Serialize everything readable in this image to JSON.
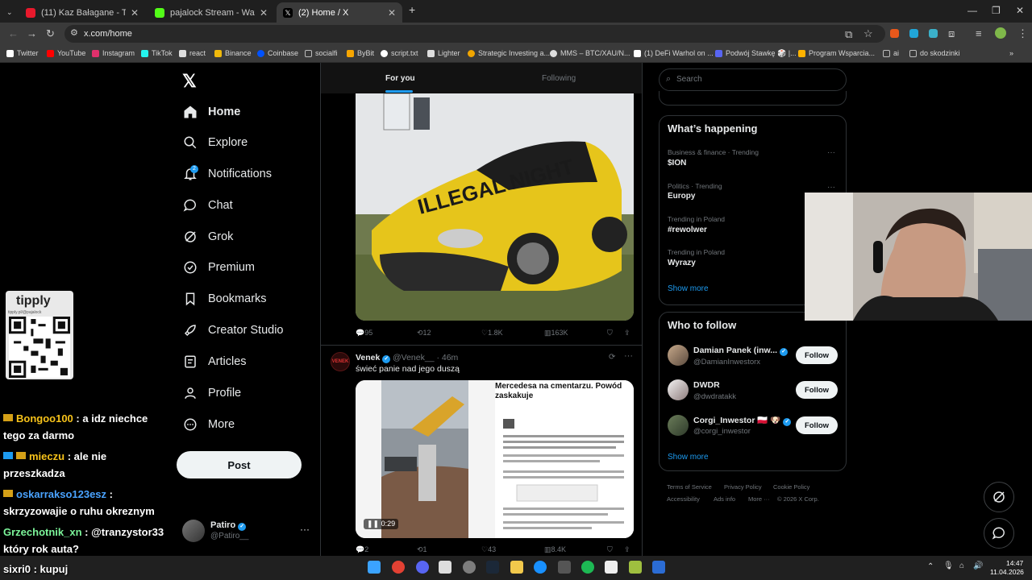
{
  "browser": {
    "tabs": [
      {
        "title": "(11) Kaz Bałagane - Trendsetter",
        "color": "#e8192c"
      },
      {
        "title": "pajalock Stream - Watch Live o",
        "color": "#53fc18"
      },
      {
        "title": "(2) Home / X",
        "color": "#000000"
      }
    ],
    "url": "x.com/home",
    "bookmarks": [
      {
        "label": "Twitter",
        "color": "#ffffff"
      },
      {
        "label": "YouTube",
        "color": "#ff0000"
      },
      {
        "label": "Instagram",
        "color": "#e1306c"
      },
      {
        "label": "TikTok",
        "color": "#25f4ee"
      },
      {
        "label": "react",
        "color": "#dddddd"
      },
      {
        "label": "Binance",
        "color": "#f0b90b"
      },
      {
        "label": "Coinbase",
        "color": "#0052ff"
      },
      {
        "label": "socialfi",
        "color": "#aaaaaa"
      },
      {
        "label": "ByBit",
        "color": "#f7a600"
      },
      {
        "label": "script.txt",
        "color": "#ffffff"
      },
      {
        "label": "Lighter",
        "color": "#dddddd"
      },
      {
        "label": "Strategic Investing a...",
        "color": "#f0a500"
      },
      {
        "label": "MMS – BTC/XAU/N...",
        "color": "#dddddd"
      },
      {
        "label": "(1) DeFi Warhol on ...",
        "color": "#ffffff"
      },
      {
        "label": "Podwój Stawkę 🎲 |...",
        "color": "#5865f2"
      },
      {
        "label": "Program Wsparcia...",
        "color": "#ffb300"
      },
      {
        "label": "ai",
        "color": "#aaaaaa"
      },
      {
        "label": "do skodzinki",
        "color": "#aaaaaa"
      }
    ]
  },
  "x": {
    "nav": [
      {
        "label": "Home",
        "icon": "home-icon"
      },
      {
        "label": "Explore",
        "icon": "search-icon"
      },
      {
        "label": "Notifications",
        "icon": "bell-icon"
      },
      {
        "label": "Chat",
        "icon": "chat-icon"
      },
      {
        "label": "Grok",
        "icon": "grok-icon"
      },
      {
        "label": "Premium",
        "icon": "premium-icon"
      },
      {
        "label": "Bookmarks",
        "icon": "bookmark-icon"
      },
      {
        "label": "Creator Studio",
        "icon": "rocket-icon"
      },
      {
        "label": "Articles",
        "icon": "articles-icon"
      },
      {
        "label": "Profile",
        "icon": "profile-icon"
      },
      {
        "label": "More",
        "icon": "more-icon"
      }
    ],
    "notification_count": "2",
    "post_label": "Post",
    "profile": {
      "name": "Patiro",
      "handle": "@Patiro__"
    }
  },
  "timeline": {
    "tabs": {
      "for_you": "For you",
      "following": "Following"
    },
    "tweet1": {
      "stats": {
        "replies": "95",
        "reposts": "12",
        "likes": "1.8K",
        "views": "163K"
      }
    },
    "tweet2": {
      "avatar_text": "VENEK",
      "name": "Venek",
      "handle": "@Venek__ · 46m",
      "text": "świeć panie nad jego duszą",
      "video_duration": "0:29",
      "article_headline": "Mercedesa na cmentarzu. Powód zaskakuje",
      "stats": {
        "replies": "2",
        "reposts": "1",
        "likes": "43",
        "views": "8.4K"
      }
    }
  },
  "sidebar": {
    "search_placeholder": "Search",
    "whats_happening_title": "What’s happening",
    "trends": [
      {
        "category": "Business & finance · Trending",
        "name": "$ION"
      },
      {
        "category": "Politics · Trending",
        "name": "Europy"
      },
      {
        "category": "Trending in Poland",
        "name": "#rewolwer"
      },
      {
        "category": "Trending in Poland",
        "name": "Wyrazy"
      }
    ],
    "show_more": "Show more",
    "who_to_follow_title": "Who to follow",
    "follow_label": "Follow",
    "suggestions": [
      {
        "name": "Damian Panek (inw...",
        "handle": "@DamianInwestorx",
        "verified": true
      },
      {
        "name": "DWDR",
        "handle": "@dwdratakk",
        "verified": false
      },
      {
        "name": "Corgi_Inwestor 🇵🇱 🐶",
        "handle": "@corgi_inwestor",
        "verified": true
      }
    ],
    "footer": [
      "Terms of Service",
      "Privacy Policy",
      "Cookie Policy",
      "Accessibility",
      "Ads info",
      "More ···",
      "© 2026 X Corp."
    ]
  },
  "overlay": {
    "tipply_title": "tipply",
    "tipply_url": "tipply.pl/@pajalock",
    "chat": [
      {
        "user": "Bongoo100",
        "message": ": a idz niechce tego za darmo",
        "color": "#f6c21a"
      },
      {
        "user": "mieczu",
        "message": ": ale nie przeszkadza",
        "color": "#f6c21a"
      },
      {
        "user": "oskarrakso123esz",
        "message": ": skrzyzowajie o ruhu okreznym",
        "color": "#4aa3ff"
      },
      {
        "user": "Grzechotnik_xn",
        "message": ": @tranzystor33 który rok auta?",
        "color": "#7cf59a"
      },
      {
        "user": "sixri0",
        "message": ": kupuj",
        "color": "#ffffff"
      }
    ]
  },
  "taskbar": {
    "time": "14:47",
    "date": "11.04.2026"
  }
}
